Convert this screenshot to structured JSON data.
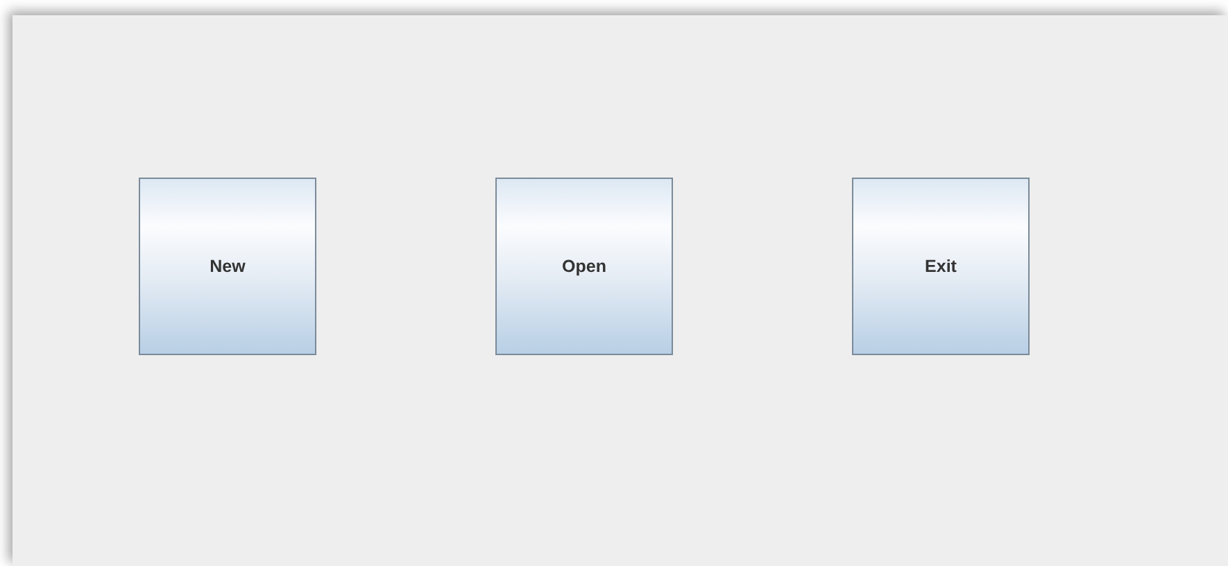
{
  "buttons": [
    {
      "label": "New"
    },
    {
      "label": "Open"
    },
    {
      "label": "Exit"
    }
  ]
}
